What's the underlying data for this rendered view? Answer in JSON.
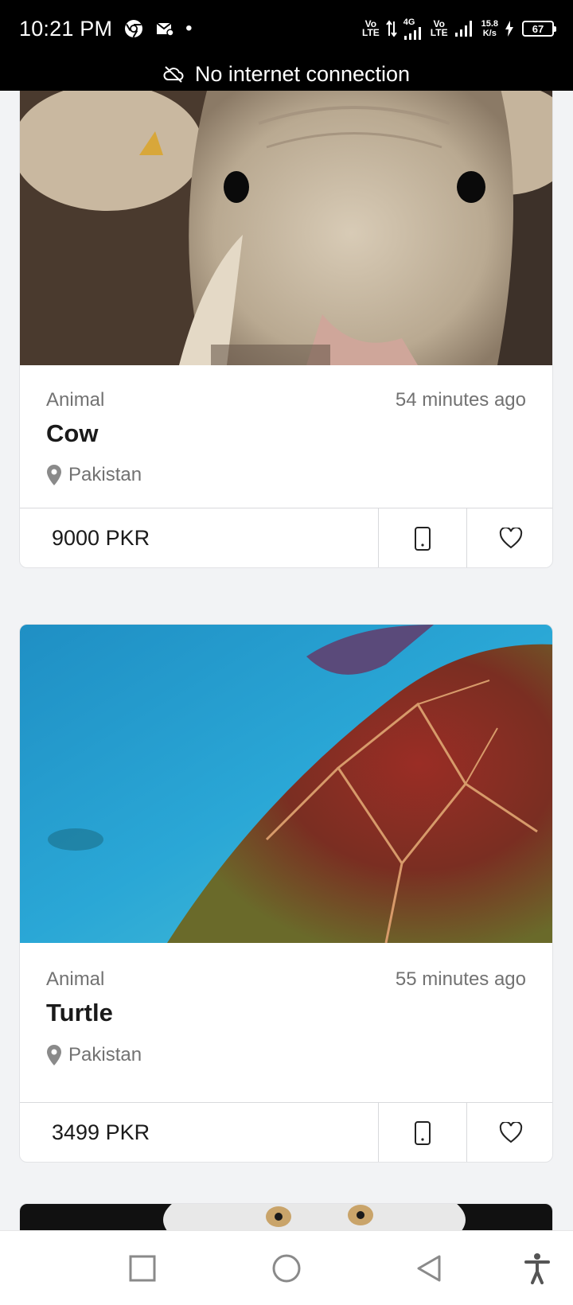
{
  "status_bar": {
    "time": "10:21 PM",
    "dot": "•",
    "vo1_top": "Vo",
    "vo1_bottom": "LTE",
    "net_type": "4G",
    "vo2_top": "Vo",
    "vo2_bottom": "LTE",
    "speed_value": "15.8",
    "speed_unit": "K/s",
    "battery": "67",
    "icons": [
      "chrome-icon",
      "mail-icon",
      "volte-icon",
      "data-arrows-icon",
      "signal-icon",
      "signal-icon-2",
      "charging-icon",
      "battery-icon"
    ]
  },
  "offline_banner": {
    "text": "No internet connection",
    "icon": "cloud-off-icon"
  },
  "listings": [
    {
      "category": "Animal",
      "time_ago": "54 minutes ago",
      "title": "Cow",
      "location": "Pakistan",
      "price": "9000 PKR"
    },
    {
      "category": "Animal",
      "time_ago": "55 minutes ago",
      "title": "Turtle",
      "location": "Pakistan",
      "price": "3499 PKR"
    }
  ],
  "actions": {
    "call_icon": "phone-icon",
    "favorite_icon": "heart-icon",
    "location_icon": "location-pin-icon"
  },
  "nav_bar": {
    "items": [
      "recents-button",
      "home-button",
      "back-button",
      "accessibility-button"
    ]
  },
  "colors": {
    "status_bar": "#000000",
    "background": "#f2f3f5",
    "card": "#ffffff",
    "muted_text": "#727272",
    "title_text": "#1a1a1a",
    "turtle_water": "#2aa7d6"
  }
}
